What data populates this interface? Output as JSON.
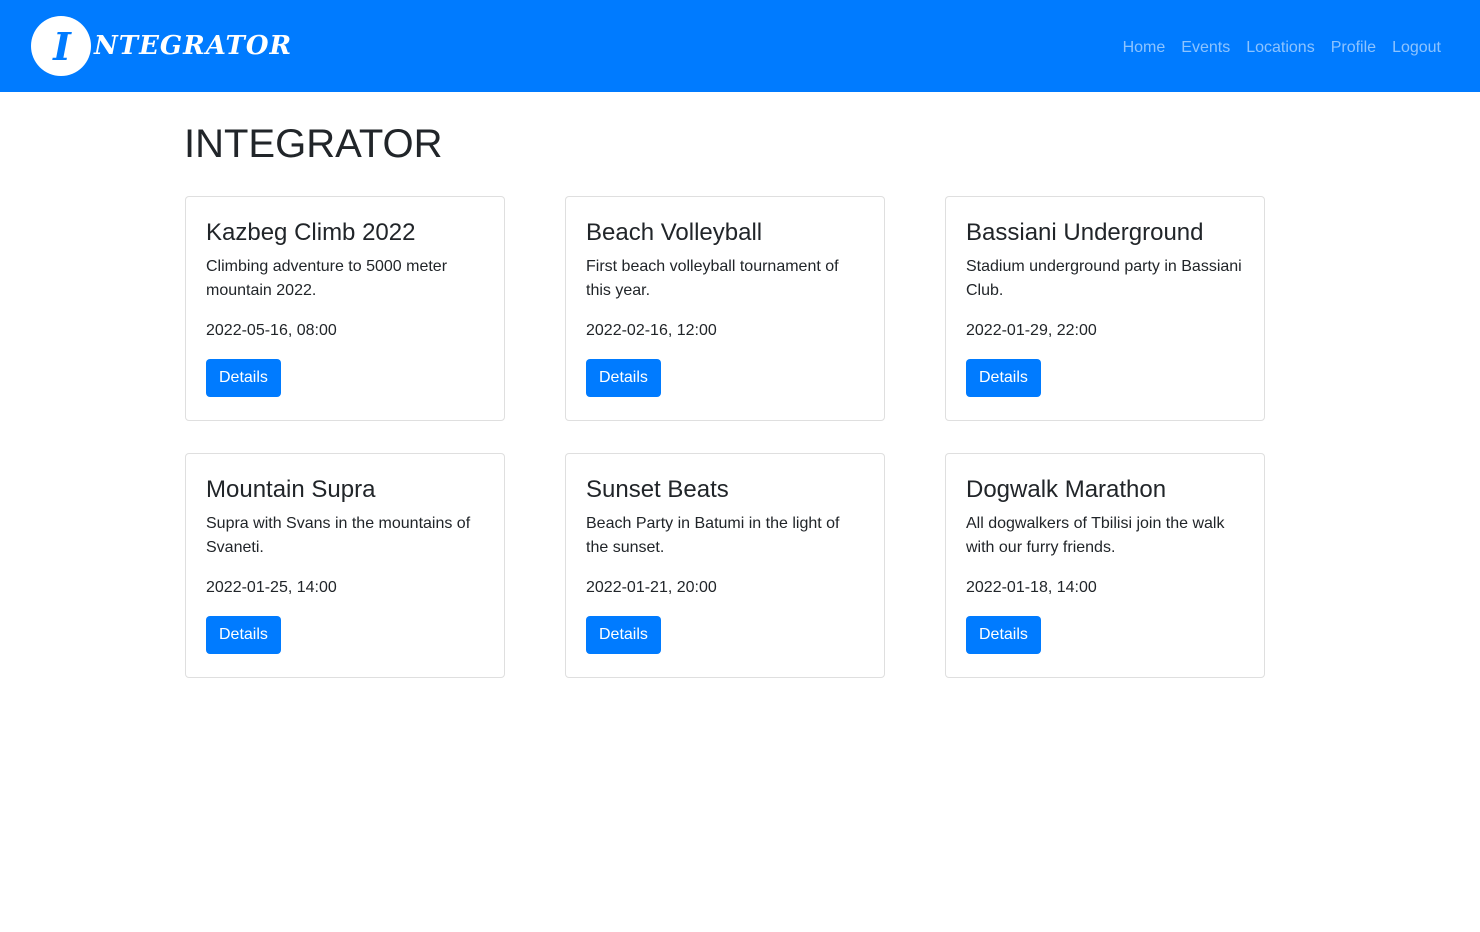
{
  "navbar": {
    "brand_initial": "I",
    "brand_rest": "NTEGRATOR",
    "links": [
      {
        "label": "Home"
      },
      {
        "label": "Events"
      },
      {
        "label": "Locations"
      },
      {
        "label": "Profile"
      },
      {
        "label": "Logout"
      }
    ]
  },
  "page_title": "INTEGRATOR",
  "colors": {
    "primary": "#007bff",
    "text": "#212529",
    "nav_link": "rgba(255,255,255,0.55)"
  },
  "events": [
    {
      "title": "Kazbeg Climb 2022",
      "description": "Climbing adventure to 5000 meter mountain 2022.",
      "datetime": "2022-05-16, 08:00",
      "button_label": "Details"
    },
    {
      "title": "Beach Volleyball",
      "description": "First beach volleyball tournament of this year.",
      "datetime": "2022-02-16, 12:00",
      "button_label": "Details"
    },
    {
      "title": "Bassiani Underground",
      "description": "Stadium underground party in Bassiani Club.",
      "datetime": "2022-01-29, 22:00",
      "button_label": "Details"
    },
    {
      "title": "Mountain Supra",
      "description": "Supra with Svans in the mountains of Svaneti.",
      "datetime": "2022-01-25, 14:00",
      "button_label": "Details"
    },
    {
      "title": "Sunset Beats",
      "description": "Beach Party in Batumi in the light of the sunset.",
      "datetime": "2022-01-21, 20:00",
      "button_label": "Details"
    },
    {
      "title": "Dogwalk Marathon",
      "description": "All dogwalkers of Tbilisi join the walk with our furry friends.",
      "datetime": "2022-01-18, 14:00",
      "button_label": "Details"
    }
  ]
}
